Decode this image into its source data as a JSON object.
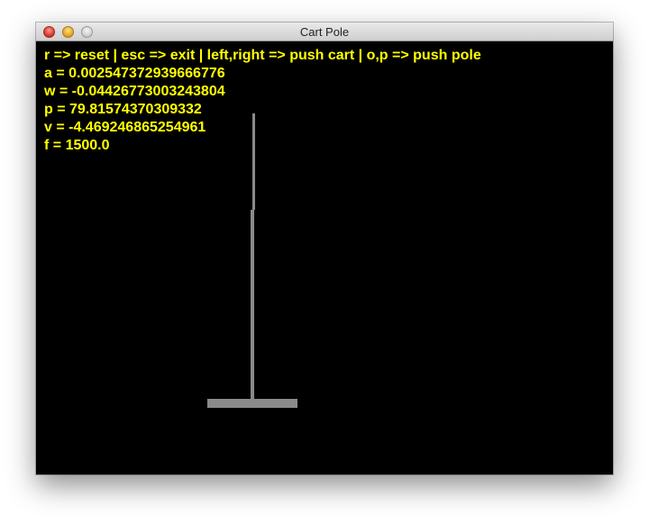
{
  "window": {
    "title": "Cart Pole",
    "buttons": [
      "close-icon",
      "minimize-icon",
      "zoom-icon"
    ]
  },
  "hud": {
    "help": "r => reset | esc => exit | left,right => push cart | o,p => push pole",
    "a": "a = 0.002547372939666776",
    "w": "w = -0.04426773003243804",
    "p": "p = 79.81574370309332",
    "v": "v = -4.469246865254961",
    "f": "f = 1500.0"
  },
  "colors": {
    "background": "#000000",
    "text": "#ffff00",
    "cart": "#8a8a8a",
    "pole": "#8a8a8a"
  }
}
